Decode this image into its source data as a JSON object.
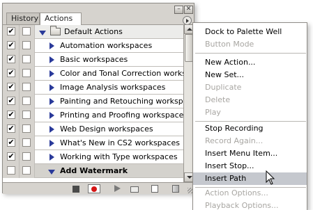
{
  "palette": {
    "tabs": {
      "history": "History",
      "actions": "Actions"
    },
    "default_set": {
      "label": "Default Actions"
    },
    "rows": [
      {
        "label": "Automation workspaces",
        "checked": true
      },
      {
        "label": "Basic workspaces",
        "checked": true
      },
      {
        "label": "Color and Tonal Correction worksp...",
        "checked": true
      },
      {
        "label": "Image Analysis workspaces",
        "checked": true
      },
      {
        "label": "Painting and Retouching workspaces",
        "checked": true
      },
      {
        "label": "Printing and Proofing workspaces",
        "checked": true
      },
      {
        "label": "Web Design workspaces",
        "checked": true
      },
      {
        "label": "What's New in CS2 workspaces",
        "checked": true
      },
      {
        "label": "Working with Type workspaces",
        "checked": true
      }
    ],
    "selected_row": {
      "label": "Add Watermark",
      "checked": false
    },
    "check_glyph": "✔"
  },
  "menu": {
    "items": [
      {
        "label": "Dock to Palette Well",
        "enabled": true
      },
      {
        "label": "Button Mode",
        "enabled": false
      },
      {
        "label": "New Action...",
        "enabled": true
      },
      {
        "label": "New Set...",
        "enabled": true
      },
      {
        "label": "Duplicate",
        "enabled": false
      },
      {
        "label": "Delete",
        "enabled": false
      },
      {
        "label": "Play",
        "enabled": false
      },
      {
        "label": "Stop Recording",
        "enabled": true
      },
      {
        "label": "Record Again...",
        "enabled": false
      },
      {
        "label": "Insert Menu Item...",
        "enabled": true
      },
      {
        "label": "Insert Stop...",
        "enabled": true
      },
      {
        "label": "Insert Path",
        "enabled": true,
        "highlighted": true
      },
      {
        "label": "Action Options...",
        "enabled": false
      },
      {
        "label": "Playback Options...",
        "enabled": false
      }
    ]
  },
  "colors": {
    "highlight": "#c5c8ce",
    "record": "#d41515",
    "disclosure": "#2a3a9a"
  }
}
